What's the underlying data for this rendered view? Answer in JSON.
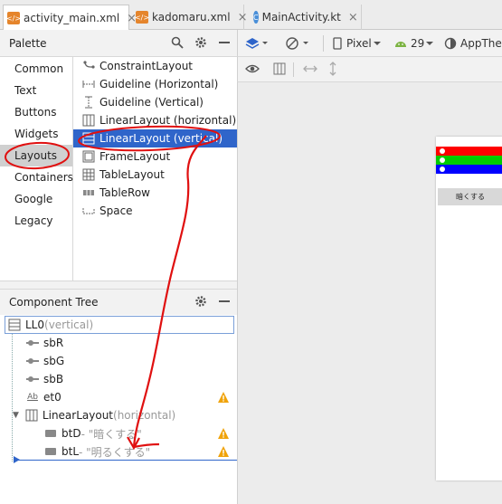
{
  "tabs": [
    {
      "label": "activity_main.xml",
      "icon": "xml-file-icon",
      "active": true
    },
    {
      "label": "kadomaru.xml",
      "icon": "xml-file-icon",
      "active": false
    },
    {
      "label": "MainActivity.kt",
      "icon": "kotlin-file-icon",
      "active": false
    }
  ],
  "close_glyph": "×",
  "palette": {
    "title": "Palette",
    "categories": [
      "Common",
      "Text",
      "Buttons",
      "Widgets",
      "Layouts",
      "Containers",
      "Google",
      "Legacy"
    ],
    "selected_category": "Layouts",
    "widgets": [
      {
        "label": "ConstraintLayout",
        "icon": "constraint-layout-icon"
      },
      {
        "label": "Guideline (Horizontal)",
        "icon": "guideline-horizontal-icon"
      },
      {
        "label": "Guideline (Vertical)",
        "icon": "guideline-vertical-icon"
      },
      {
        "label": "LinearLayout (horizontal)",
        "icon": "linear-layout-horizontal-icon"
      },
      {
        "label": "LinearLayout (vertical)",
        "icon": "linear-layout-vertical-icon"
      },
      {
        "label": "FrameLayout",
        "icon": "frame-layout-icon"
      },
      {
        "label": "TableLayout",
        "icon": "table-layout-icon"
      },
      {
        "label": "TableRow",
        "icon": "table-row-icon"
      },
      {
        "label": "Space",
        "icon": "space-icon"
      }
    ],
    "selected_widget": "LinearLayout (vertical)"
  },
  "component_tree": {
    "title": "Component Tree",
    "root": {
      "id": "LL0",
      "type": "(vertical)"
    },
    "items": [
      {
        "id": "sbR",
        "icon": "seekbar-icon",
        "warning": false
      },
      {
        "id": "sbG",
        "icon": "seekbar-icon",
        "warning": false
      },
      {
        "id": "sbB",
        "icon": "seekbar-icon",
        "warning": false
      },
      {
        "id": "et0",
        "icon": "edittext-icon",
        "icon_text": "Ab",
        "warning": true
      }
    ],
    "group": {
      "name": "LinearLayout",
      "type": "(horizontal)",
      "expand_glyph": "▼"
    },
    "children": [
      {
        "id": "btD",
        "text": "- \"暗くする\"",
        "warning": true
      },
      {
        "id": "btL",
        "text": "- \"明るくする\"",
        "warning": true
      }
    ]
  },
  "design_toolbar": {
    "device": "Pixel",
    "api": "29",
    "theme": "AppTheme"
  },
  "preview": {
    "bars": [
      {
        "name": "red-bar",
        "color": "#ff0000"
      },
      {
        "name": "green-bar",
        "color": "#00cc00"
      },
      {
        "name": "blue-bar",
        "color": "#0000ff"
      }
    ],
    "button_label": "暗くする"
  },
  "colors": {
    "selection": "#2f65ca",
    "annotation": "#e01010",
    "warning": "#f0a30a"
  }
}
